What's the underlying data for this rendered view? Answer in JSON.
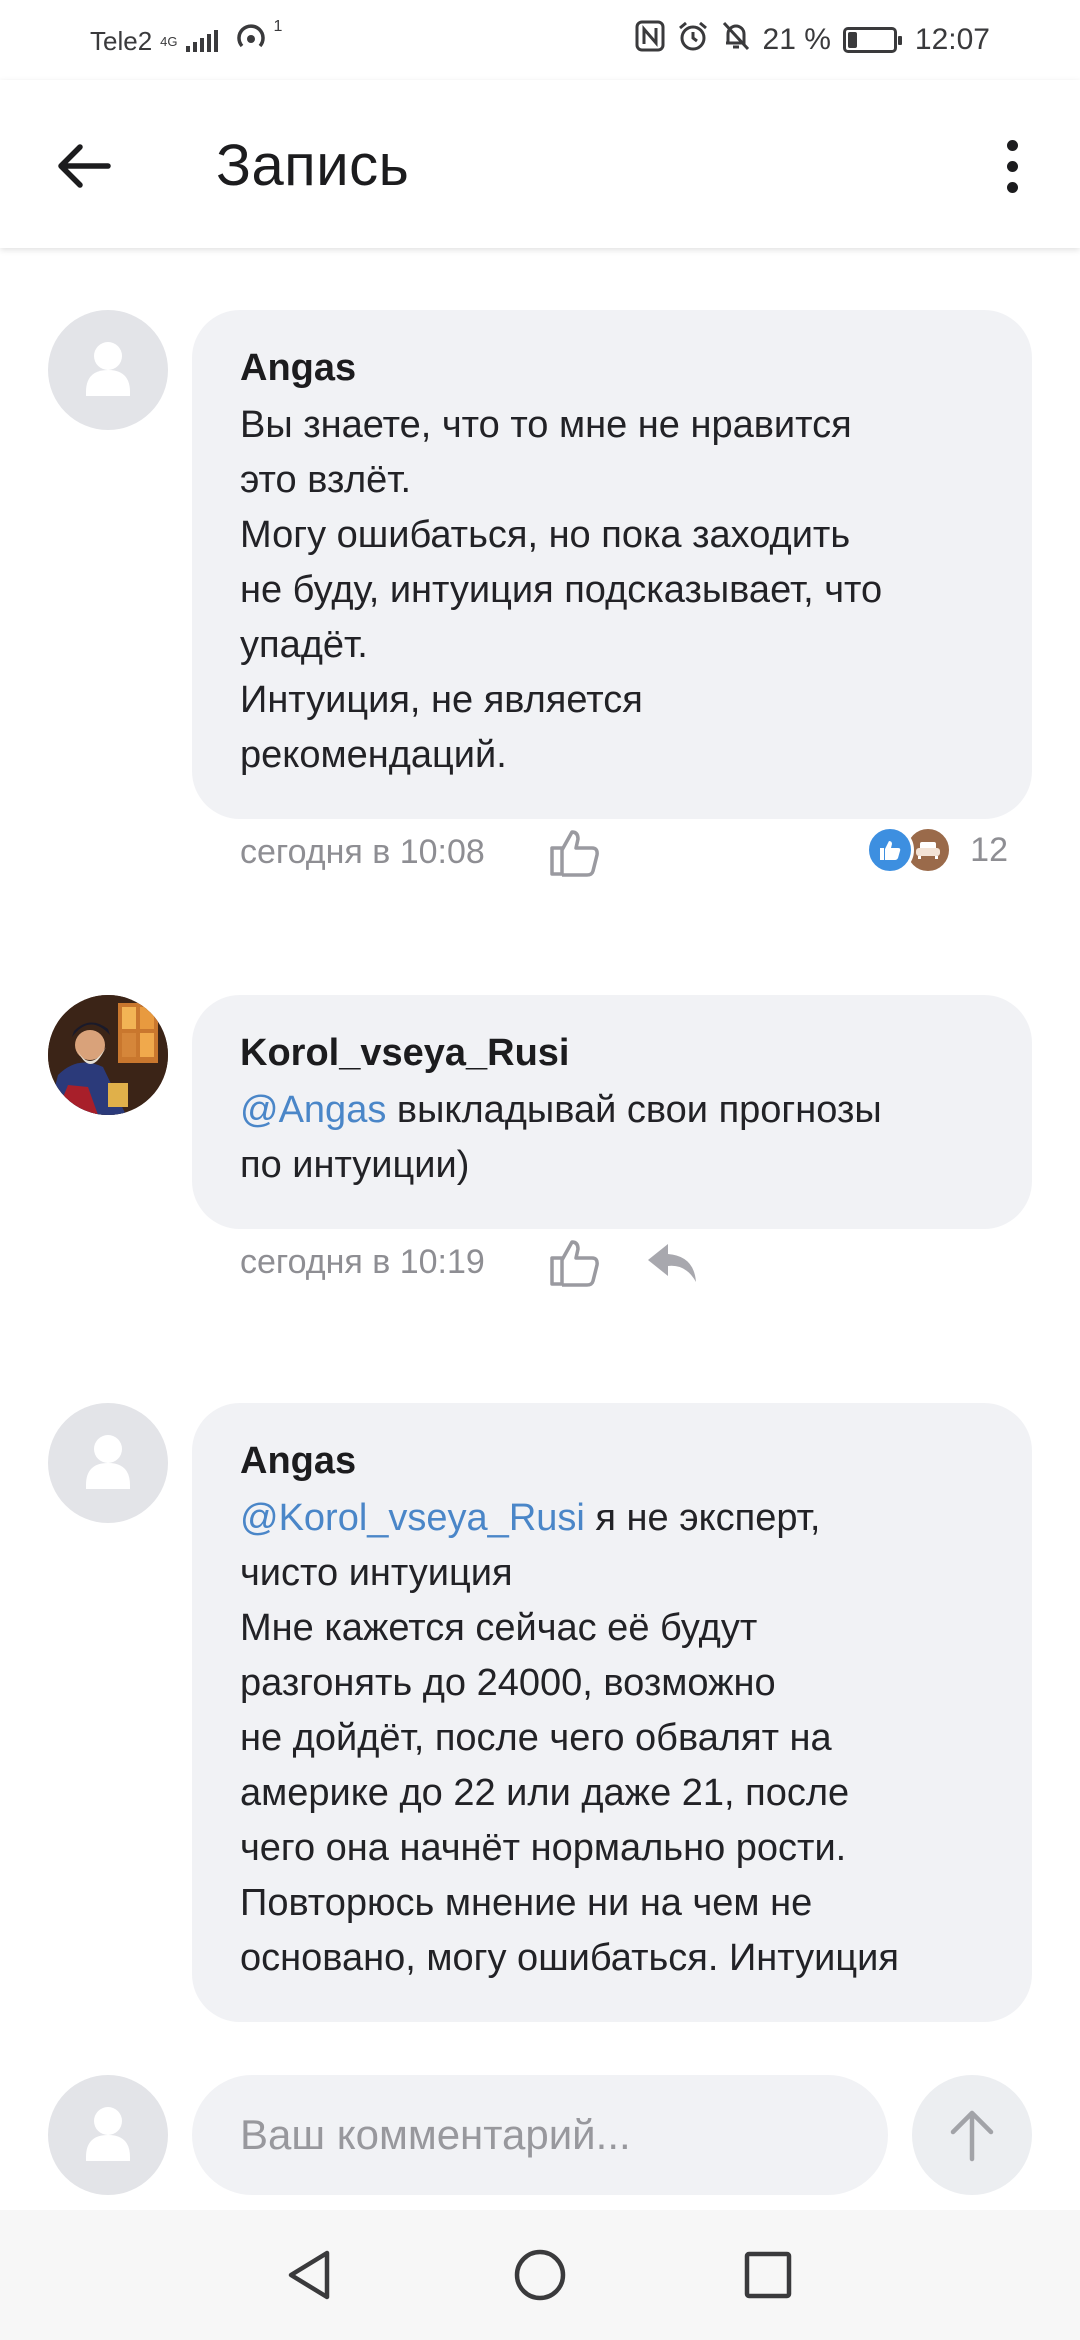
{
  "status_bar": {
    "carrier": "Tele2",
    "network_type": "4G",
    "hotspot_count": "1",
    "battery_percent": "21 %",
    "battery_level": 0.21,
    "time": "12:07",
    "icons": [
      "nfc-icon",
      "alarm-icon",
      "mute-icon",
      "battery-icon"
    ]
  },
  "header": {
    "title": "Запись",
    "back_icon": "arrow-left-icon",
    "menu_icon": "more-vertical-icon"
  },
  "comments": [
    {
      "author": "Angas",
      "text": "Вы знаете, что то мне не нравится\nэто взлёт.\nМогу ошибаться, но пока заходить\nне буду, интуиция подсказывает, что\nупадёт.\nИнтуиция, не является\nрекомендаций.",
      "time": "сегодня в 10:08",
      "reactions_count": "12",
      "reaction_icons": [
        "thumbs-up-icon",
        "sofa-icon"
      ]
    },
    {
      "author": "Korol_vseya_Rusi",
      "mention": "@Angas",
      "text": " выкладывай свои прогнозы\nпо интуиции)",
      "time": "сегодня в 10:19"
    },
    {
      "author": "Angas",
      "mention": "@Korol_vseya_Rusi",
      "text": " я не эксперт,\nчисто интуиция\nМне кажется сейчас её будут\nразгонять до 24000, возможно\nне дойдёт, после чего обвалят на\nамерике до 22 или даже 21, после\nчего она начнёт нормально рости.\nПовторюсь мнение ни на чем не\nосновано, могу ошибаться. Интуиция"
    }
  ],
  "input": {
    "placeholder": "Ваш комментарий..."
  },
  "colors": {
    "accent": "#4a86c8",
    "bubble": "#f1f2f5",
    "meta_text": "#8e8e93"
  }
}
